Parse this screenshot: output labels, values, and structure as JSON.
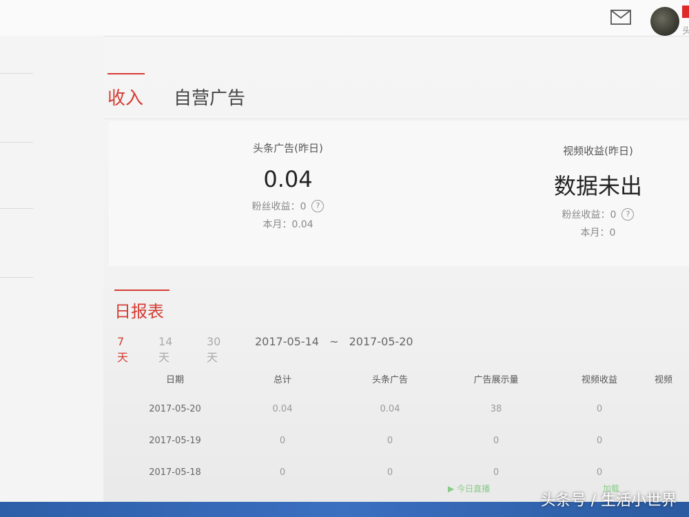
{
  "header": {
    "user_initial": "头"
  },
  "tabs": [
    {
      "label": "收入"
    },
    {
      "label": "自营广告"
    }
  ],
  "income": {
    "toutiao": {
      "title": "头条广告(昨日)",
      "value": "0.04",
      "fans": "粉丝收益：0",
      "month": "本月：0.04"
    },
    "video": {
      "title": "视频收益(昨日)",
      "value": "数据未出",
      "fans": "粉丝收益：0",
      "month": "本月：0"
    }
  },
  "report": {
    "title": "日报表",
    "ranges": [
      "7天",
      "14天",
      "30天"
    ],
    "date_start": "2017-05-14",
    "date_sep": "~",
    "date_end": "2017-05-20",
    "columns": [
      "日期",
      "总计",
      "头条广告",
      "广告展示量",
      "视频收益",
      "视频"
    ],
    "rows": [
      [
        "2017-05-20",
        "0.04",
        "0.04",
        "38",
        "0"
      ],
      [
        "2017-05-19",
        "0",
        "0",
        "0",
        "0"
      ],
      [
        "2017-05-18",
        "0",
        "0",
        "0",
        "0"
      ]
    ]
  },
  "bottom": {
    "tool1": "今日直播",
    "tool2": "加载"
  },
  "watermark": "头条号 / 生活小世界",
  "colors": {
    "accent": "#d43c33",
    "taskbar": "#2d5fa8"
  }
}
